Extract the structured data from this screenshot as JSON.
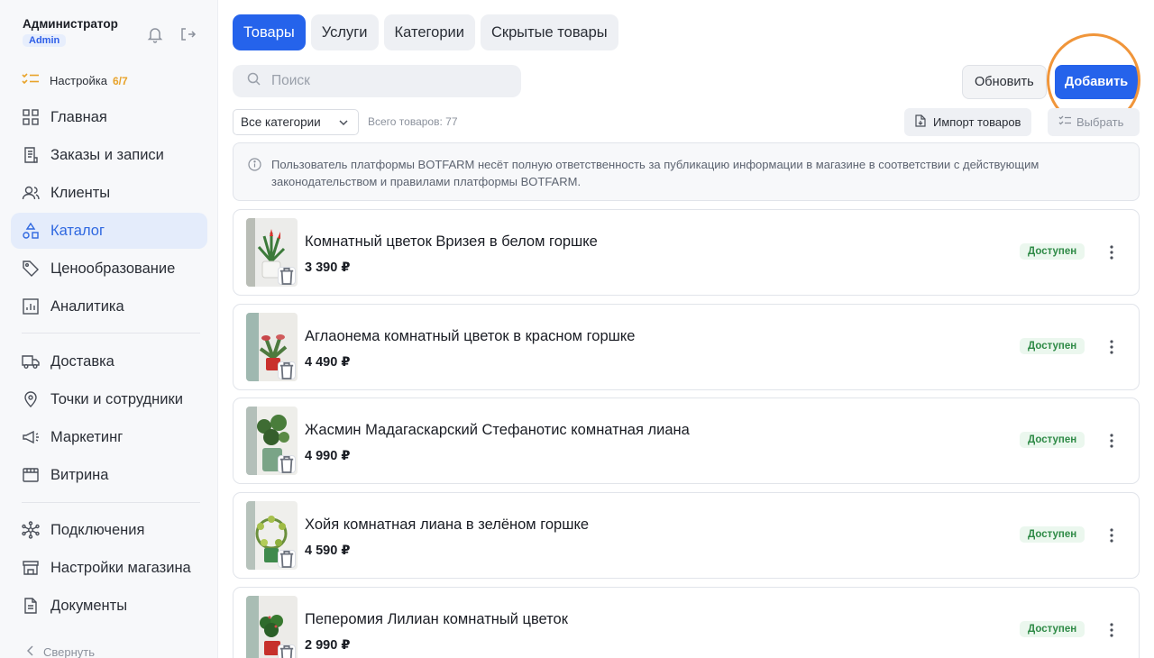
{
  "user": {
    "name": "Администратор",
    "role": "Admin"
  },
  "setup": {
    "label": "Настройка",
    "progress": "6/7"
  },
  "nav_group1": [
    {
      "label": "Главная",
      "icon": "grid-icon"
    },
    {
      "label": "Заказы и записи",
      "icon": "receipt-icon"
    },
    {
      "label": "Клиенты",
      "icon": "users-icon"
    },
    {
      "label": "Каталог",
      "icon": "shapes-icon",
      "active": true
    },
    {
      "label": "Ценообразование",
      "icon": "tag-icon"
    },
    {
      "label": "Аналитика",
      "icon": "chart-icon"
    }
  ],
  "nav_group2": [
    {
      "label": "Доставка",
      "icon": "truck-icon"
    },
    {
      "label": "Точки и сотрудники",
      "icon": "location-icon"
    },
    {
      "label": "Маркетинг",
      "icon": "megaphone-icon"
    },
    {
      "label": "Витрина",
      "icon": "storefront-icon"
    }
  ],
  "nav_group3": [
    {
      "label": "Подключения",
      "icon": "network-icon"
    },
    {
      "label": "Настройки магазина",
      "icon": "store-icon"
    },
    {
      "label": "Документы",
      "icon": "document-icon"
    }
  ],
  "collapse_label": "Свернуть",
  "tabs": [
    "Товары",
    "Услуги",
    "Категории",
    "Скрытые товары"
  ],
  "search": {
    "placeholder": "Поиск"
  },
  "buttons": {
    "refresh": "Обновить",
    "add": "Добавить",
    "import": "Импорт товаров",
    "select": "Выбрать"
  },
  "filter": {
    "category": "Все категории",
    "total": "Всего товаров: 77"
  },
  "notice": "Пользователь платформы BOTFARM несёт полную ответственность за публикацию информации в магазине в соответствии с действующим законодательством и правилами платформы BOTFARM.",
  "colors": {
    "accent": "#2563eb",
    "status_green": "#2e8a46",
    "highlight_ring": "#f0953a",
    "setup_progress": "#e8a32a"
  },
  "products": [
    {
      "title": "Комнатный цветок Вризея в белом горшке",
      "price": "3 390 ₽",
      "status": "Доступен"
    },
    {
      "title": "Аглаонема комнатный цветок в красном горшке",
      "price": "4 490 ₽",
      "status": "Доступен"
    },
    {
      "title": "Жасмин Мадагаскарский Стефанотис комнатная лиана",
      "price": "4 990 ₽",
      "status": "Доступен"
    },
    {
      "title": "Хойя комнатная лиана в зелёном горшке",
      "price": "4 590 ₽",
      "status": "Доступен"
    },
    {
      "title": "Пеперомия Лилиан комнатный цветок",
      "price": "2 990 ₽",
      "status": "Доступен"
    }
  ]
}
